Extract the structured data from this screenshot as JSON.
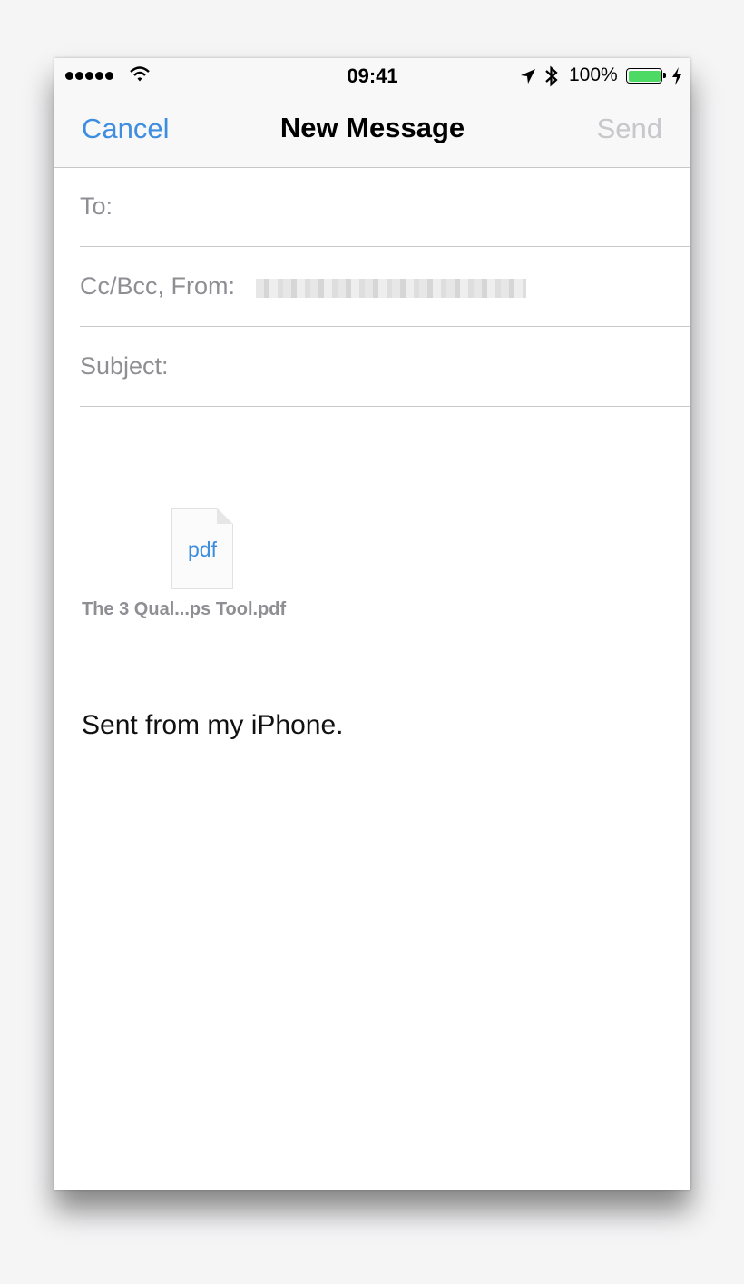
{
  "status_bar": {
    "time": "09:41",
    "battery_percent": "100%",
    "battery_level": 1.0,
    "signal_bars": 5,
    "icons": [
      "signal-dots-icon",
      "wifi-icon",
      "location-arrow-icon",
      "bluetooth-icon",
      "battery-icon",
      "charging-bolt-icon"
    ],
    "battery_color": "#4cd964"
  },
  "nav": {
    "cancel_label": "Cancel",
    "title": "New Message",
    "send_label": "Send",
    "accent_color": "#3e8ee0"
  },
  "fields": {
    "to_label": "To:",
    "cc_from_label": "Cc/Bcc, From:",
    "subject_label": "Subject:"
  },
  "attachment": {
    "icon_text": "pdf",
    "file_name": "The 3 Qual...ps Tool.pdf"
  },
  "body": {
    "signature": "Sent from my iPhone."
  }
}
